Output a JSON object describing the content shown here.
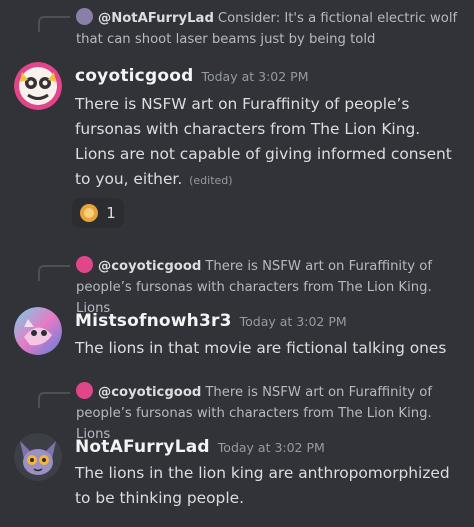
{
  "messages": [
    {
      "reply": {
        "author": "@NotAFurryLad",
        "text": "Consider: It's a fictional electric wolf that can shoot laser beams just by being told"
      },
      "author": "coyoticgood",
      "timestamp": "Today at 3:02 PM",
      "text": "There is NSFW art on Furaffinity of people’s fursonas with characters from The Lion King. Lions are not capable of giving informed consent to you, either.",
      "edited": "(edited)",
      "reaction": {
        "emoji": "lion-emoji",
        "count": "1"
      }
    },
    {
      "reply": {
        "author": "@coyoticgood",
        "text": "There is NSFW art on Furaffinity of people’s fursonas with characters from The Lion King. Lions"
      },
      "author": "Mistsofnowh3r3",
      "timestamp": "Today at 3:02 PM",
      "text": "The lions in that movie are fictional talking ones"
    },
    {
      "reply": {
        "author": "@coyoticgood",
        "text": "There is NSFW art on Furaffinity of people’s fursonas with characters from The Lion King. Lions"
      },
      "author": "NotAFurryLad",
      "timestamp": "Today at 3:02 PM",
      "text": "The lions in the lion king are anthropomorphized to be thinking people."
    }
  ],
  "colors": {
    "background": "#313338",
    "username": "#f2f3f5",
    "text": "#dbdee1",
    "muted": "#949ba4"
  }
}
